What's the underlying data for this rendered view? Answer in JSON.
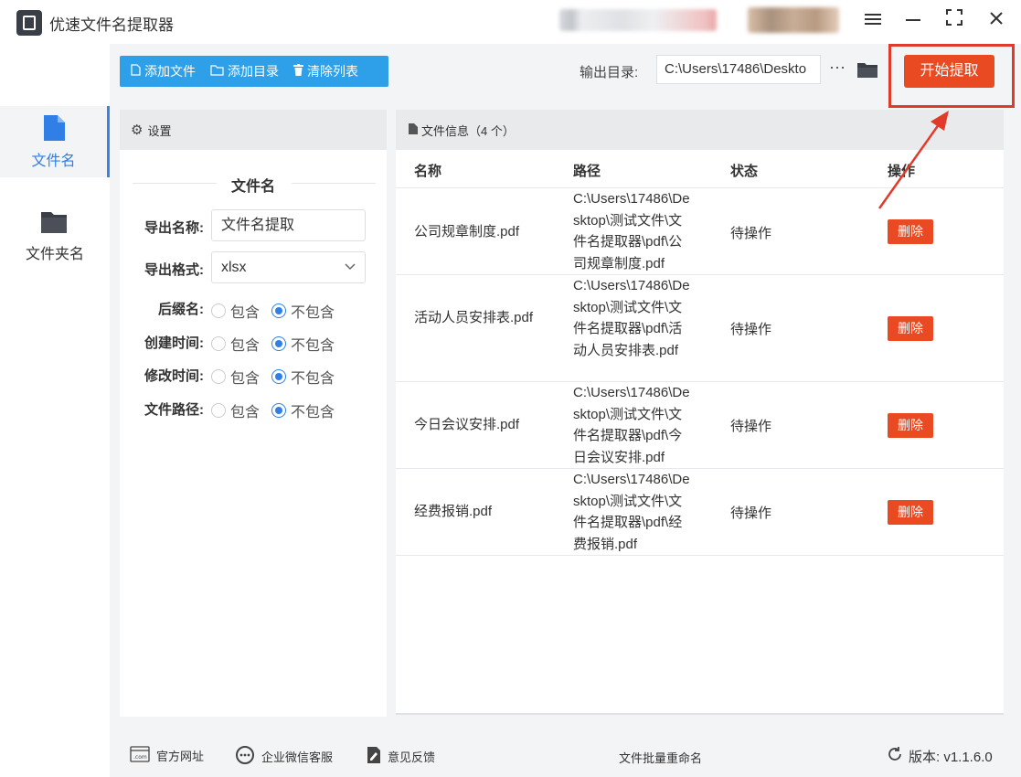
{
  "app": {
    "title": "优速文件名提取器"
  },
  "window_controls": [
    "menu",
    "minimize",
    "maximize",
    "close"
  ],
  "nav": {
    "items": [
      {
        "label": "文件名",
        "icon": "file-icon",
        "active": true
      },
      {
        "label": "文件夹名",
        "icon": "folder-icon",
        "active": false
      }
    ]
  },
  "toolbar": {
    "add_file": "添加文件",
    "add_dir": "添加目录",
    "clear_list": "清除列表",
    "output_label": "输出目录:",
    "output_path": "C:\\Users\\17486\\Deskto",
    "more": "···",
    "start": "开始提取"
  },
  "settings": {
    "header": "设置",
    "section_title": "文件名",
    "export_name_label": "导出名称:",
    "export_name_value": "文件名提取",
    "export_format_label": "导出格式:",
    "export_format_value": "xlsx",
    "options": [
      {
        "label": "后缀名:",
        "include": "包含",
        "exclude": "不包含",
        "selected": "exclude"
      },
      {
        "label": "创建时间:",
        "include": "包含",
        "exclude": "不包含",
        "selected": "exclude"
      },
      {
        "label": "修改时间:",
        "include": "包含",
        "exclude": "不包含",
        "selected": "exclude"
      },
      {
        "label": "文件路径:",
        "include": "包含",
        "exclude": "不包含",
        "selected": "exclude"
      }
    ]
  },
  "filelist": {
    "header": "文件信息（4 个）",
    "columns": [
      "名称",
      "路径",
      "状态",
      "操作"
    ],
    "rows": [
      {
        "name": "公司规章制度.pdf",
        "path": "C:\\Users\\17486\\Desktop\\测试文件\\文件名提取器\\pdf\\公司规章制度.pdf",
        "status": "待操作",
        "action": "删除"
      },
      {
        "name": "活动人员安排表.pdf",
        "path": "C:\\Users\\17486\\Desktop\\测试文件\\文件名提取器\\pdf\\活动人员安排表.pdf",
        "status": "待操作",
        "action": "删除"
      },
      {
        "name": "今日会议安排.pdf",
        "path": "C:\\Users\\17486\\Desktop\\测试文件\\文件名提取器\\pdf\\今日会议安排.pdf",
        "status": "待操作",
        "action": "删除"
      },
      {
        "name": "经费报销.pdf",
        "path": "C:\\Users\\17486\\Desktop\\测试文件\\文件名提取器\\pdf\\经费报销.pdf",
        "status": "待操作",
        "action": "删除"
      }
    ]
  },
  "footer": {
    "website": "官方网址",
    "support": "企业微信客服",
    "feedback": "意见反馈",
    "center": "文件批量重命名",
    "version": "版本: v1.1.6.0"
  },
  "colors": {
    "accent_blue": "#2ea0ea",
    "active_blue": "#2f7fe6",
    "danger": "#ea4a22",
    "highlight_red": "#e03a2a"
  }
}
